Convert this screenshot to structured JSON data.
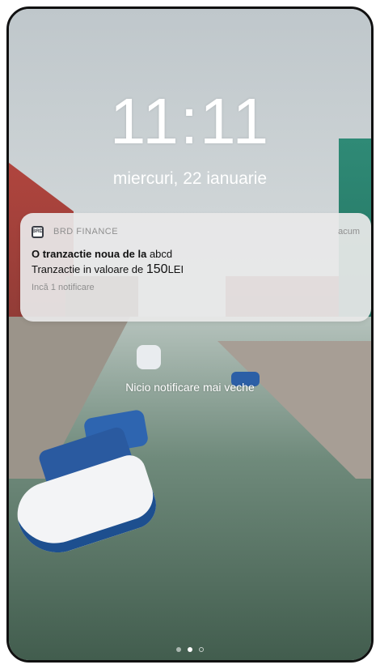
{
  "lockscreen": {
    "time": "11:11",
    "date": "miercuri, 22 ianuarie",
    "no_older_notifications": "Nicio notificare mai veche"
  },
  "notification": {
    "app_icon_label": "BRD",
    "app_name": "BRD FINANCE",
    "time": "acum",
    "title_bold": "O tranzactie noua de la",
    "title_rest": " abcd",
    "body_prefix": "Tranzactie in valoare de ",
    "body_amount": "150",
    "body_currency": "LEI",
    "more": "Incă 1 notificare"
  },
  "page_indicator": {
    "pages": 3,
    "active_index": 1,
    "colors": {
      "active": "#ffffff",
      "inactive": "#ffffff8c"
    }
  }
}
